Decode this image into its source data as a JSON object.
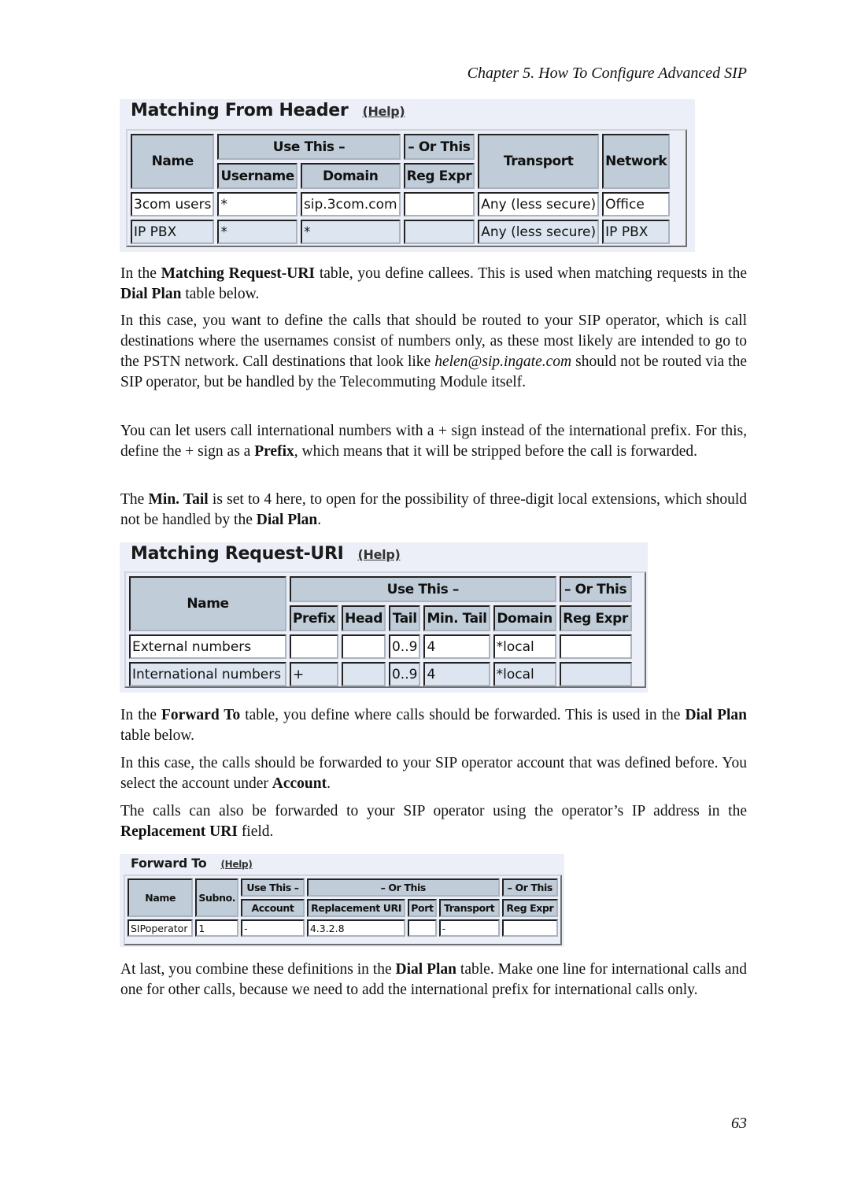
{
  "page": {
    "running_head": "Chapter 5. How To Configure Advanced SIP",
    "page_number": "63"
  },
  "tables": {
    "from_header": {
      "title": "Matching From Header",
      "help": "(Help)",
      "group_use_this": "Use This –",
      "group_or_this": "– Or This",
      "columns": [
        "Name",
        "Username",
        "Domain",
        "Reg Expr",
        "Transport",
        "Network"
      ],
      "rows": [
        [
          "3com users",
          "*",
          "sip.3com.com",
          "",
          "Any (less secure)",
          "Office"
        ],
        [
          "IP PBX",
          "*",
          "*",
          "",
          "Any (less secure)",
          "IP PBX"
        ]
      ]
    },
    "request_uri": {
      "title": "Matching Request-URI",
      "help": "(Help)",
      "group_use_this": "Use This –",
      "group_or_this": "– Or This",
      "columns": [
        "Name",
        "Prefix",
        "Head",
        "Tail",
        "Min. Tail",
        "Domain",
        "Reg Expr"
      ],
      "rows": [
        [
          "External numbers",
          "",
          "",
          "0..9",
          "4",
          "*local",
          ""
        ],
        [
          "International numbers",
          "+",
          "",
          "0..9",
          "4",
          "*local",
          ""
        ]
      ]
    },
    "forward_to": {
      "title": "Forward To",
      "help": "(Help)",
      "group_use_this": "Use This –",
      "group_or_this_1": "– Or This",
      "group_or_this_2": "– Or This",
      "columns": [
        "Name",
        "Subno.",
        "Account",
        "Replacement URI",
        "Port",
        "Transport",
        "Reg Expr"
      ],
      "rows": [
        [
          "SIPoperator",
          "1",
          "-",
          "4.3.2.8",
          "",
          "-",
          ""
        ]
      ]
    }
  },
  "paragraphs": {
    "p1": {
      "a": "In the ",
      "b1": "Matching Request-URI",
      "c": " table, you define callees. This is used when matching requests in the ",
      "b2": "Dial Plan",
      "d": " table below."
    },
    "p2": {
      "a": "In this case, you want to define the calls that should be routed to your SIP operator, which is call destinations where the usernames consist of numbers only, as these most likely are intended to go to the PSTN network. Call destinations that look like ",
      "i1": "helen@sip.ingate.com",
      "b": " should not be routed via the SIP operator, but be handled by the Telecommuting Module itself."
    },
    "p3": {
      "a": "You can let users call international numbers with a + sign instead of the international prefix. For this, define the + sign as a ",
      "b1": "Prefix",
      "c": ", which means that it will be stripped before the call is forwarded."
    },
    "p4": {
      "a": "The ",
      "b1": "Min. Tail",
      "c": " is set to 4 here, to open for the possibility of three-digit local extensions, which should not be handled by the ",
      "b2": "Dial Plan",
      "d": "."
    },
    "p5": {
      "a": "In the ",
      "b1": "Forward To",
      "c": " table, you define where calls should be forwarded. This is used in the ",
      "b2": "Dial Plan",
      "d": " table below."
    },
    "p6": {
      "a": "In this case, the calls should be forwarded to your SIP operator account that was defined before. You select the account under ",
      "b1": "Account",
      "c": "."
    },
    "p7": {
      "a": "The calls can also be forwarded to your SIP operator using the operator’s IP address in the ",
      "b1": "Replacement URI",
      "c": " field."
    },
    "p8": {
      "a": "At last, you combine these definitions in the ",
      "b1": "Dial Plan",
      "c": " table. Make one line for international calls and one for other calls, because we need to add the international prefix for international calls only."
    }
  }
}
